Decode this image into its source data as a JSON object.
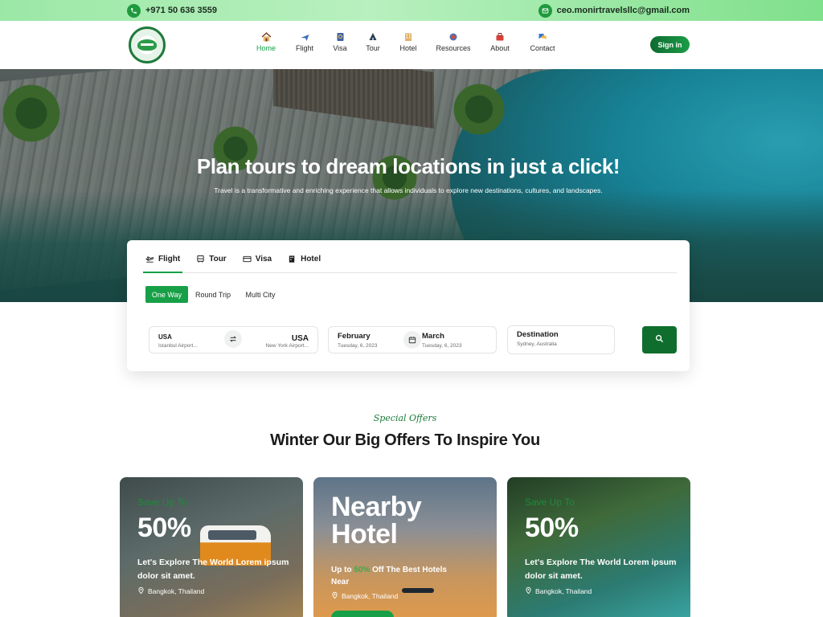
{
  "colors": {
    "brand": "#17a047",
    "brand_dark": "#0f6e2e",
    "text": "#1b1b1b",
    "topbar": "#9be8a6"
  },
  "topbar": {
    "phone": "+971 50 636 3559",
    "email": "ceo.monirtravelsllc@gmail.com",
    "phone_icon": "phone-icon",
    "email_icon": "mail-icon"
  },
  "header": {
    "logo_icon": "monir-travel-logo",
    "nav": [
      {
        "label": "Home",
        "icon": "home-icon",
        "active": true
      },
      {
        "label": "Flight",
        "icon": "plane-icon",
        "active": false
      },
      {
        "label": "Visa",
        "icon": "passport-icon",
        "active": false
      },
      {
        "label": "Tour",
        "icon": "tour-icon",
        "active": false
      },
      {
        "label": "Hotel",
        "icon": "hotel-icon",
        "active": false
      },
      {
        "label": "Resources",
        "icon": "resources-icon",
        "active": false
      },
      {
        "label": "About",
        "icon": "about-icon",
        "active": false
      },
      {
        "label": "Contact",
        "icon": "contact-icon",
        "active": false
      }
    ],
    "signin": "Sign in"
  },
  "hero": {
    "title": "Plan tours to dream locations in just a click!",
    "subtitle": "Travel is a transformative and enriching experience that allows individuals to explore new destinations, cultures, and landscapes."
  },
  "search": {
    "tabs": [
      {
        "label": "Flight",
        "icon": "takeoff-icon",
        "active": true
      },
      {
        "label": "Tour",
        "icon": "bus-icon",
        "active": false
      },
      {
        "label": "Visa",
        "icon": "ticket-icon",
        "active": false
      },
      {
        "label": "Hotel",
        "icon": "building-icon",
        "active": false
      }
    ],
    "trip_types": [
      {
        "label": "One Way",
        "active": true
      },
      {
        "label": "Round Trip",
        "active": false
      },
      {
        "label": "Multi City",
        "active": false
      }
    ],
    "from": {
      "country": "USA",
      "airport": "Istanbul Airport..."
    },
    "to": {
      "country": "USA",
      "airport": "New York Airport..."
    },
    "swap_icon": "swap-icon",
    "depart": {
      "month": "February",
      "date": "Tuesday, 6, 2023"
    },
    "return": {
      "month": "March",
      "date": "Tuesday, 6, 2023"
    },
    "calendar_icon": "calendar-icon",
    "destination": {
      "label": "Destination",
      "value": "Sydney, Australia"
    },
    "search_icon": "search-icon"
  },
  "offers": {
    "tag": "Special Offers",
    "title": "Winter Our Big Offers To Inspire You",
    "cards": [
      {
        "kicker": "Save Up To",
        "big": "50%",
        "text": "Let's Explore The World Lorem ipsum dolor sit amet.",
        "location": "Bangkok, Thailand"
      },
      {
        "title_line1": "Nearby",
        "title_line2": "Hotel",
        "text_pre": "Up to",
        "pct": "50%",
        "text_post": "Off The Best Hotels Near",
        "location": "Bangkok, Thailand"
      },
      {
        "kicker": "Save Up To",
        "big": "50%",
        "text": "Let's Explore The World Lorem ipsum dolor sit amet.",
        "location": "Bangkok, Thailand"
      }
    ]
  }
}
